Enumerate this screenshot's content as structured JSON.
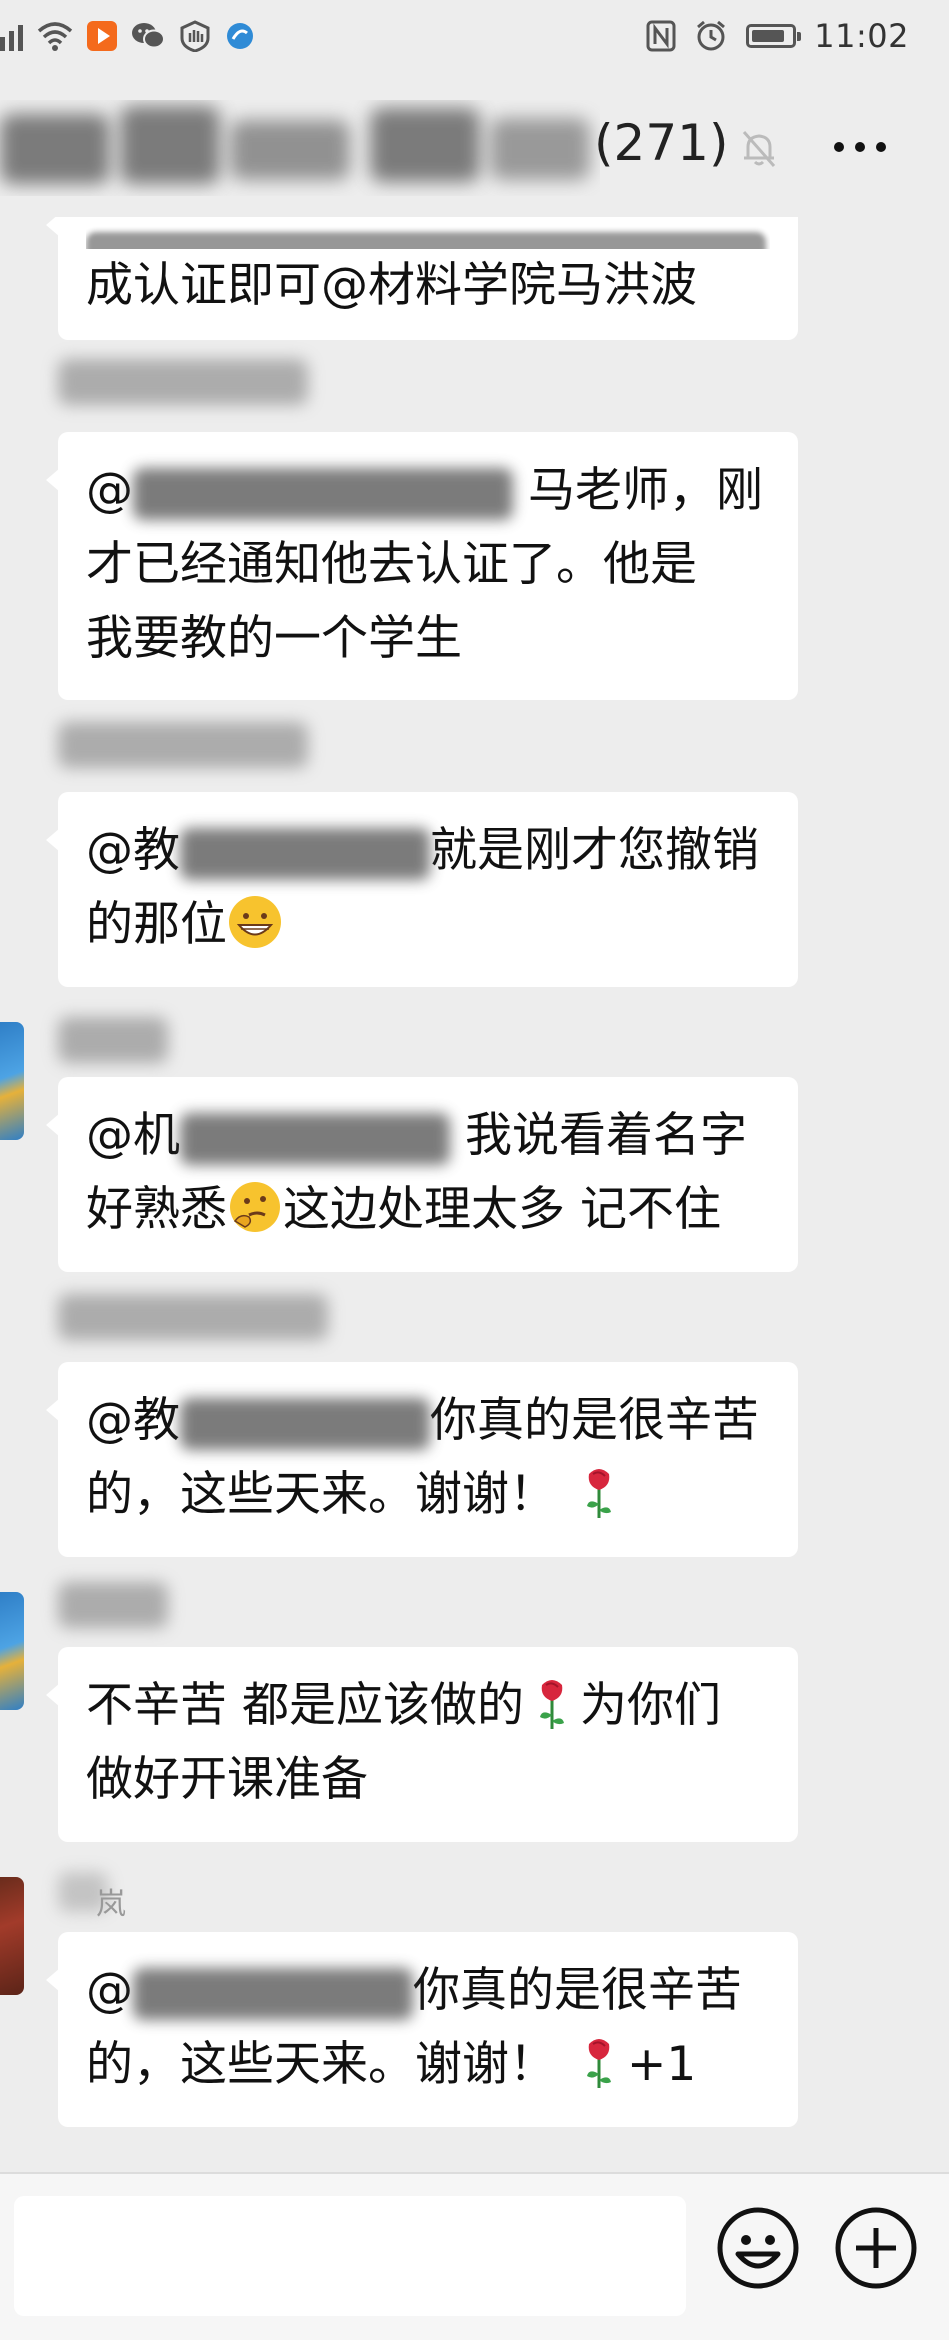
{
  "status_bar": {
    "time": "11:02",
    "battery_level": 0.85,
    "icons": [
      "signal-icon",
      "wifi-icon",
      "video-app-icon",
      "wechat-icon",
      "shield-app-icon",
      "browser-app-icon",
      "nfc-icon",
      "alarm-icon",
      "battery-icon"
    ]
  },
  "header": {
    "title_visible_suffix": "(271)",
    "mute_icon": "bell-off-icon",
    "more_icon": "more-dots-icon"
  },
  "messages": [
    {
      "id": "m0",
      "text": "成认证即可@材料学院马洪波",
      "partial_top": true
    },
    {
      "id": "m1",
      "prefix": "@",
      "text_after_blur": "马老师，刚",
      "line2": "才已经通知他去认证了。他是",
      "line3": "我要教的一个学生"
    },
    {
      "id": "m2",
      "prefix": "@教",
      "text_after_blur": "就是刚才您撤销",
      "line2": "的那位"
    },
    {
      "id": "m3",
      "prefix": "@机",
      "text_after_blur": "我说看着名字",
      "line2_a": "好熟悉",
      "line2_b": "这边处理太多  记不住"
    },
    {
      "id": "m4",
      "prefix": "@教",
      "text_after_blur": "你真的是很辛苦",
      "line2": "的，这些天来。谢谢！"
    },
    {
      "id": "m5",
      "line1_a": "不辛苦 都是应该做的",
      "line1_b": "为你们",
      "line2": "做好开课准备"
    },
    {
      "id": "m6",
      "sender_partial": "岚",
      "prefix": "@",
      "text_after_blur": "你真的是很辛苦",
      "line2": "的，这些天来。谢谢！",
      "line2_suffix": "+1"
    }
  ],
  "input_bar": {
    "placeholder": "",
    "emoji_icon": "smiley-icon",
    "plus_icon": "plus-circle-icon"
  },
  "colors": {
    "background": "#ededed",
    "bubble": "#ffffff",
    "text": "#111111"
  }
}
